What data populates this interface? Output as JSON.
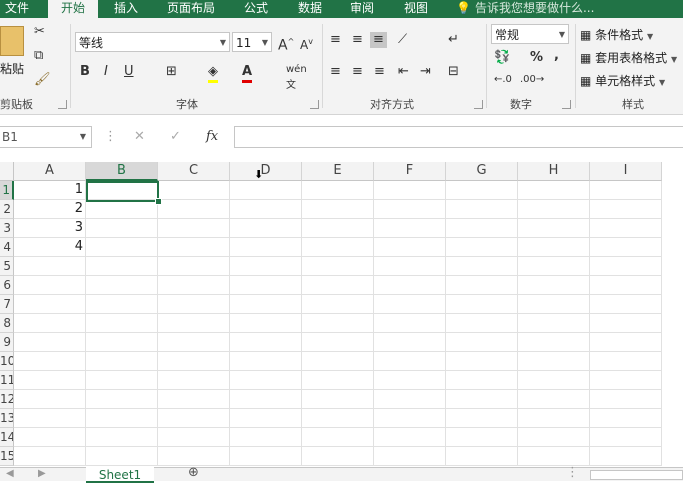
{
  "tabs": [
    "文件",
    "开始",
    "插入",
    "页面布局",
    "公式",
    "数据",
    "审阅",
    "视图"
  ],
  "tell_me": "告诉我您想要做什么...",
  "clipboard": {
    "paste_label": "粘贴",
    "group_label": "剪贴板"
  },
  "font": {
    "name": "等线",
    "size": "11",
    "group_label": "字体",
    "bold": "B",
    "italic": "I",
    "underline": "U"
  },
  "alignment": {
    "group_label": "对齐方式"
  },
  "number": {
    "format": "常规",
    "percent": "%",
    "comma": ",",
    "group_label": "数字"
  },
  "styles": {
    "conditional": "条件格式",
    "table": "套用表格格式",
    "cell": "单元格样式",
    "group_label": "样式"
  },
  "formula_bar": {
    "name_box": "B1",
    "fx": "fx",
    "value": ""
  },
  "columns": [
    "A",
    "B",
    "C",
    "D",
    "E",
    "F",
    "G",
    "H",
    "I"
  ],
  "rows": [
    "1",
    "2",
    "3",
    "4",
    "5",
    "6",
    "7",
    "8",
    "9",
    "10",
    "11",
    "12",
    "13",
    "14",
    "15"
  ],
  "cells": {
    "A1": "1",
    "A2": "2",
    "A3": "3",
    "A4": "4"
  },
  "selected_cell": "B1",
  "sheet_tab": "Sheet1",
  "colors": {
    "accent": "#217346"
  }
}
